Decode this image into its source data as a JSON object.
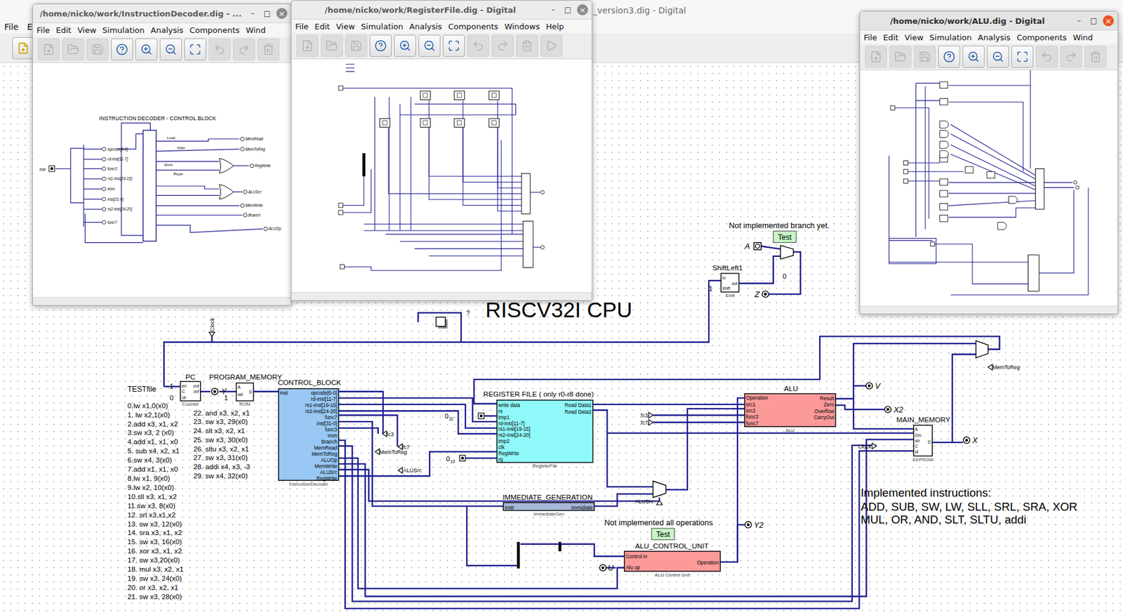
{
  "main_window": {
    "title": "_version3.dig - Digital",
    "menu": [
      "File",
      "E"
    ]
  },
  "windows": [
    {
      "kind": "decoder",
      "title": "/home/nicko/work/InstructionDecoder.dig - ...",
      "active": false,
      "controls": [
        "–",
        "□",
        "×"
      ],
      "menu": [
        "File",
        "Edit",
        "View",
        "Simulation",
        "Analysis",
        "Components",
        "Wind"
      ],
      "toolbar": [
        {
          "disabled": true
        },
        {
          "disabled": true
        },
        {
          "disabled": true
        },
        {
          "disabled": false
        },
        {
          "disabled": false
        },
        {
          "disabled": false
        },
        {
          "disabled": false
        },
        {
          "disabled": true
        },
        {
          "disabled": true
        },
        {
          "disabled": true
        }
      ],
      "diagram": {
        "title": "INSTRUCTION DECODER - CONTROL BLOCK",
        "input": "inst",
        "fields": [
          "opcode[6-0]",
          "rd-inst[11-7]",
          "func3",
          "rs1-inst[19-15]",
          "imm",
          "inst[31-0]",
          "rs2-inst[24-20]",
          "func7"
        ],
        "gates": [
          "Load",
          "Itype",
          "Store",
          "Rtype"
        ],
        "outputs": [
          "MemRead",
          "MemToReg",
          "RegWrite",
          "ALUSrc",
          "MemWrite",
          "Branch",
          "ALUOp"
        ]
      }
    },
    {
      "kind": "register-file",
      "title": "/home/nicko/work/RegisterFile.dig - Digital",
      "active": false,
      "controls": [
        "–",
        "□",
        "×"
      ],
      "menu": [
        "File",
        "Edit",
        "View",
        "Simulation",
        "Analysis",
        "Components",
        "Windows",
        "Help"
      ],
      "toolbar": [
        {
          "disabled": true
        },
        {
          "disabled": true
        },
        {
          "disabled": true
        },
        {
          "disabled": false
        },
        {
          "disabled": false
        },
        {
          "disabled": false
        },
        {
          "disabled": false
        },
        {
          "disabled": true
        },
        {
          "disabled": true
        },
        {
          "disabled": true
        },
        {
          "disabled": true
        }
      ]
    },
    {
      "kind": "alu",
      "title": "/home/nicko/work/ALU.dig - Digital",
      "active": true,
      "controls": [
        "–",
        "□",
        "×"
      ],
      "menu": [
        "File",
        "Edit",
        "View",
        "Simulation",
        "Analysis",
        "Components",
        "Wind"
      ],
      "toolbar": [
        {
          "disabled": true
        },
        {
          "disabled": true
        },
        {
          "disabled": true
        },
        {
          "disabled": false
        },
        {
          "disabled": false
        },
        {
          "disabled": false
        },
        {
          "disabled": false
        },
        {
          "disabled": true
        },
        {
          "disabled": true
        },
        {
          "disabled": true
        }
      ]
    }
  ],
  "canvas": {
    "title": "RISCV32I CPU",
    "notes": [
      "Not implemented branch yet.",
      "Not implemented all operations"
    ],
    "test_buttons": [
      {
        "label": "Test"
      },
      {
        "label": "Test"
      }
    ],
    "probe": {
      "label": "?"
    },
    "components": [
      {
        "title": "PC",
        "inputs": [
          "en",
          "C",
          "clr"
        ],
        "outputs": [
          "out",
          "ovf"
        ],
        "caption": "Counter",
        "color": "#ffffff"
      },
      {
        "title": "PROGRAM_MEMORY",
        "inputs": [
          "A",
          "sel"
        ],
        "outputs": [
          "D"
        ],
        "caption": "ROM",
        "color": "#ffffff"
      },
      {
        "title": "CONTROL_BLOCK",
        "inputs": [
          "inst"
        ],
        "outputs": [
          "opcode[6-0]",
          "rd-inst[11-7]",
          "rs1-inst[19-15]",
          "rs2-inst[24-20]",
          "func7",
          "inst[31-0]",
          "func3",
          "imm",
          "Branch",
          "MemRead",
          "MemToReg",
          "ALUOp",
          "MemWrite",
          "ALUSrc",
          "RegWrite"
        ],
        "caption": "InstructionDecoder",
        "color": "#99c8f5"
      },
      {
        "title": "REGISTER FILE ( only r0-r8 done)",
        "inputs": [
          "write data",
          "rs",
          "tmp1",
          "rd-inst[11-7]",
          "rs1-inst[19-15]",
          "rs2-inst[24-20]",
          "tmp2",
          "clk",
          "RegWrite",
          "rg"
        ],
        "outputs": [
          "Read Data1",
          "Read Data2"
        ],
        "caption": "RegisterFile",
        "color": "#8ff8f8"
      },
      {
        "title": "IMMEDIATE_GENERATION",
        "inputs": [
          "instr"
        ],
        "outputs": [
          "immidiate"
        ],
        "caption": "ImmediateGen",
        "color": "#a7b8d8"
      },
      {
        "title": "ALU",
        "inputs": [
          "Operation",
          "src1",
          "src2",
          "func3",
          "func7"
        ],
        "outputs": [
          "Result",
          "Zero",
          "Overflow",
          "CarryOut"
        ],
        "caption": "ALU",
        "color": "#fc9a9a"
      },
      {
        "title": "MAIN_MEMORY",
        "inputs": [
          "A",
          "Din",
          "str",
          "C",
          "ld"
        ],
        "outputs": [
          "D"
        ],
        "caption": "EEPROM",
        "color": "#ffffff"
      },
      {
        "title": "ALU_CONTROL_UNIT",
        "inputs": [
          "Control in",
          "Alu op"
        ],
        "outputs": [
          "Operation"
        ],
        "caption": "ALU Control Unit",
        "color": "#fc9a9a"
      },
      {
        "title": "ShiftLeft1",
        "inputs": [
          "in",
          "shift"
        ],
        "outputs": [
          "out"
        ],
        "caption": "Shift",
        "color": "#ffffff"
      }
    ],
    "pins": [
      {
        "label": "A",
        "kind": "input"
      },
      {
        "label": "Z",
        "kind": "output"
      },
      {
        "label": "Y",
        "kind": "output"
      },
      {
        "label": "V",
        "kind": "output"
      },
      {
        "label": "X2",
        "kind": "output"
      },
      {
        "label": "X",
        "kind": "output"
      },
      {
        "label": "Y2",
        "kind": "output"
      },
      {
        "label": "U",
        "kind": "output"
      }
    ],
    "constants": [
      {
        "value": "1"
      },
      {
        "value": "0"
      },
      {
        "value": "1"
      },
      {
        "value": "1"
      },
      {
        "value": "0"
      },
      {
        "value": "0",
        "bits": "32"
      },
      {
        "value": "0",
        "bits": "33"
      }
    ],
    "tunnels": [
      {
        "label": "Clock"
      },
      {
        "label": "fc3"
      },
      {
        "label": "MemToReg"
      },
      {
        "label": "fc7"
      },
      {
        "label": "ALUSrc"
      },
      {
        "label": "fc3"
      },
      {
        "label": "fc7"
      },
      {
        "label": "MemToReg"
      },
      {
        "label": "Clock"
      },
      {
        "label": "ALUSrc"
      }
    ],
    "program": {
      "title": "TESTfile",
      "lines": [
        "0.lw x1,0(x0)",
        "1. lw x2,1(x0)",
        "2.add x3, x1, x2",
        "3.sw x3, 2 (x0)",
        "4.add x1, x1, x0",
        "5. sub x4, x2, x1",
        "6.sw x4, 3(x0)",
        "7.add x1, x1, x0",
        "8.lw x1, 9(x0)",
        "9.lw x2, 10(x0)",
        "10.sll x3, x1, x2",
        "11.sw x3, 8(x0)",
        "12. srl x3,x1,x2",
        "13. sw x3, 12(x0)",
        "14. sra x3, x1, x2",
        "15. sw x3, 16(x0)",
        "16. xor x3, x1, x2",
        "17. sw x3,20(x0)",
        "18. mul x3, x2, x1",
        "19. sw x3, 24(x0)",
        "20. or x3, x2, x1",
        "21. sw x3, 28(x0)",
        "22. and x3, x2, x1",
        "23. sw x3, 29(x0)",
        "24. slt x3, x2, x1",
        "25. sw x3, 30(x0)",
        "26. sltu x3, x2, x1",
        "27. sw x3, 31(x0)",
        "28. addi x4, x3, -3",
        "29. sw x4, 32(x0)"
      ]
    },
    "implemented": {
      "title": "Implemented instructions:",
      "lines": [
        "ADD, SUB, SW, LW, SLL, SRL, SRA, XOR",
        "MUL, OR, AND, SLT, SLTU, addi"
      ]
    }
  }
}
